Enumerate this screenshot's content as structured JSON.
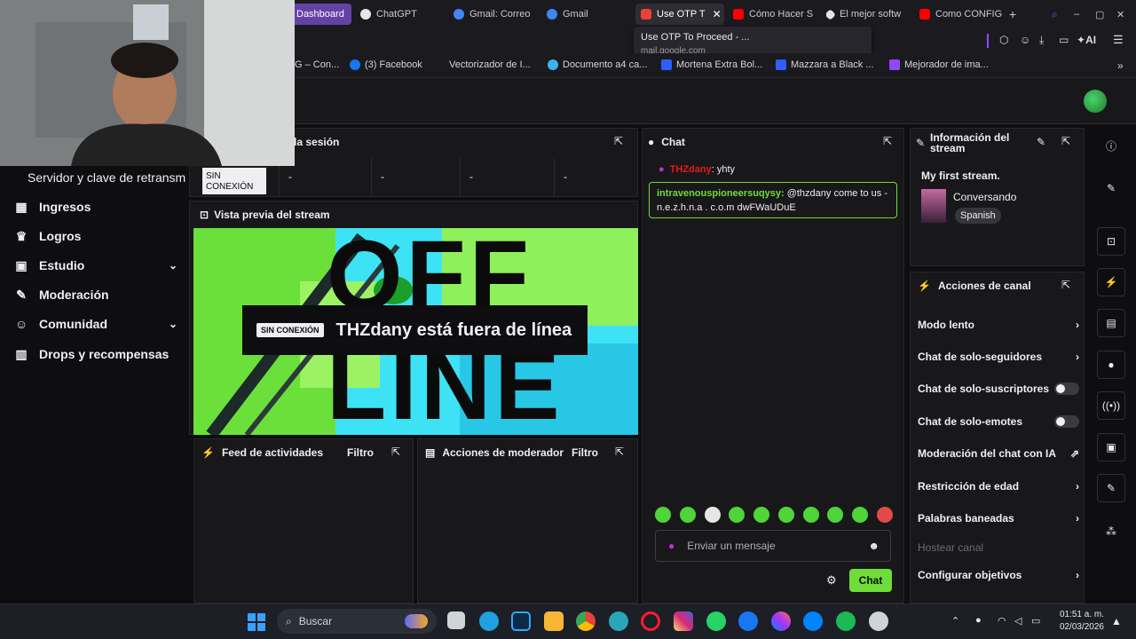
{
  "browser": {
    "tabs": [
      {
        "label": "Dashboard",
        "color": "#9147ff"
      },
      {
        "label": "ChatGPT",
        "color": "#e6e6e6"
      },
      {
        "label": "Gmail: Correo",
        "color": "#4285f4"
      },
      {
        "label": "Gmail",
        "color": "#4285f4"
      },
      {
        "label": "Use OTP T",
        "color": "#ea4335"
      },
      {
        "label": "Cómo Hacer S",
        "color": "#ff0000"
      },
      {
        "label": "El mejor softw",
        "color": "#e6e6e6"
      },
      {
        "label": "Como CONFIG",
        "color": "#ff0000"
      }
    ],
    "tooltip": {
      "title": "Use OTP To Proceed - ...",
      "url": "mail.google.com"
    },
    "bookmarks": [
      {
        "label": "G – Con...",
        "color": "#4285f4"
      },
      {
        "label": "(3) Facebook",
        "color": "#1877f2"
      },
      {
        "label": "Vectorizador de I...",
        "color": "#333333"
      },
      {
        "label": "Documento a4 ca...",
        "color": "#3bb3f0"
      },
      {
        "label": "Mortena Extra Bol...",
        "color": "#2f5dff"
      },
      {
        "label": "Mazzara a Black ...",
        "color": "#2f5dff"
      },
      {
        "label": "Mejorador de ima...",
        "color": "#9147ff"
      }
    ],
    "ai_label": "AI"
  },
  "sidebar": {
    "stream_key_label": "Servidor y clave de retransm",
    "items": [
      {
        "label": "Ingresos",
        "icon": "grid-icon",
        "glyph": "▦",
        "expand": false
      },
      {
        "label": "Logros",
        "icon": "trophy-icon",
        "glyph": "♛",
        "expand": false
      },
      {
        "label": "Estudio",
        "icon": "film-icon",
        "glyph": "▣",
        "expand": true
      },
      {
        "label": "Moderación",
        "icon": "wrench-icon",
        "glyph": "✎",
        "expand": false
      },
      {
        "label": "Comunidad",
        "icon": "people-icon",
        "glyph": "☺",
        "expand": true
      },
      {
        "label": "Drops y recompensas",
        "icon": "gift-icon",
        "glyph": "▥",
        "expand": false
      }
    ]
  },
  "session": {
    "title": "la sesión",
    "status_badge": "SIN CONEXIÓN",
    "values": [
      "-",
      "-",
      "-",
      "-"
    ]
  },
  "preview": {
    "title": "Vista previa del stream",
    "badge": "SIN CONEXIÓN",
    "offline_text": "THZdany está fuera de línea",
    "bg_word_top": "OFF",
    "bg_word_bottom": "LINE"
  },
  "feed": {
    "title": "Feed de actividades",
    "filter": "Filtro"
  },
  "mod_actions": {
    "title": "Acciones de moderador",
    "filter": "Filtro"
  },
  "chat": {
    "title": "Chat",
    "messages": [
      {
        "user": "THZdany",
        "text": ": yhty",
        "color": "#e91916"
      },
      {
        "user": "intravenouspioneersuqysy:",
        "text": " @thzdany come to us - n.e.z.h.n.a . c.o.m dwFWaUDuE",
        "color": "#6fdc37"
      }
    ],
    "placeholder": "Enviar un mensaje",
    "send_label": "Chat"
  },
  "stream_info": {
    "title": "Información del stream",
    "stream_title": "My first stream.",
    "category": "Conversando",
    "language": "Spanish"
  },
  "channel_actions": {
    "title": "Acciones de canal",
    "items": [
      {
        "label": "Modo lento",
        "control": "chevron"
      },
      {
        "label": "Chat de solo-seguidores",
        "control": "chevron"
      },
      {
        "label": "Chat de solo-suscriptores",
        "control": "toggle"
      },
      {
        "label": "Chat de solo-emotes",
        "control": "toggle"
      },
      {
        "label": "Moderación del chat con IA",
        "control": "external"
      },
      {
        "label": "Restricción de edad",
        "control": "chevron"
      },
      {
        "label": "Palabras baneadas",
        "control": "chevron"
      },
      {
        "label": "Hostear canal",
        "control": "disabled"
      },
      {
        "label": "Configurar objetivos",
        "control": "chevron"
      }
    ]
  },
  "taskbar": {
    "search_placeholder": "Buscar",
    "time": "01:51 a. m.",
    "date": "02/03/2026",
    "apps": [
      {
        "name": "file-explorer-icon",
        "color": "#f4c542"
      },
      {
        "name": "edge-icon",
        "color": "#1fa0e0"
      },
      {
        "name": "photoshop-icon",
        "color": "#31a8ff"
      },
      {
        "name": "folder-icon",
        "color": "#f7b733"
      },
      {
        "name": "chrome-icon",
        "color": "#34a853"
      },
      {
        "name": "app-icon",
        "color": "#2aa6b8"
      },
      {
        "name": "opera-icon",
        "color": "#ff1b2d"
      },
      {
        "name": "instagram-icon",
        "color": "#d62976"
      },
      {
        "name": "whatsapp-icon",
        "color": "#25d366"
      },
      {
        "name": "facebook-icon",
        "color": "#1877f2"
      },
      {
        "name": "messenger-icon",
        "color": "#a334fa"
      },
      {
        "name": "messenger-blue-icon",
        "color": "#0084ff"
      },
      {
        "name": "spotify-icon",
        "color": "#1db954"
      },
      {
        "name": "settings-app-icon",
        "color": "#cfd3da"
      }
    ]
  }
}
